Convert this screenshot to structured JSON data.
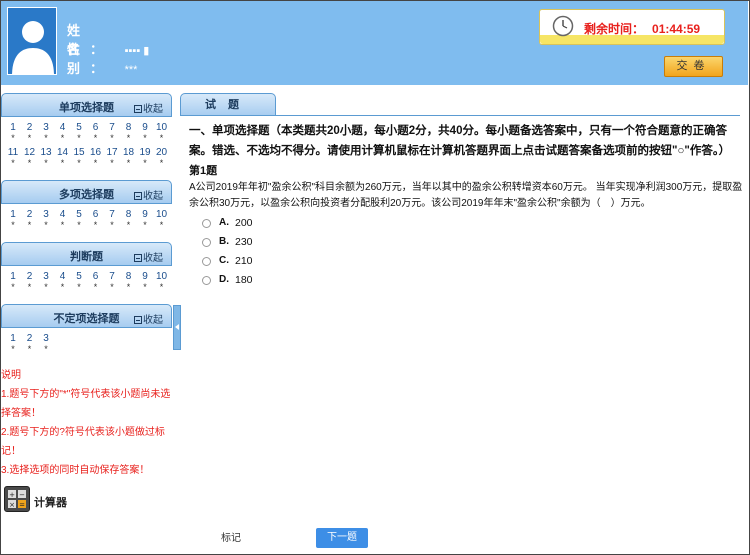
{
  "candidate": {
    "name_label": "姓名：",
    "name_value": "▪▪▪▪ ▮",
    "gender_label": "性别：",
    "gender_value": "***"
  },
  "timer": {
    "label": "剩余时间：",
    "value": "01:44:59",
    "icon": "clock-icon",
    "text_color": "#e8211d"
  },
  "submit_label": "交卷",
  "sidebar": {
    "collapse_label": "收起",
    "sections": [
      {
        "title": "单项选择题",
        "row1": [
          "1",
          "2",
          "3",
          "4",
          "5",
          "6",
          "7",
          "8",
          "9",
          "10"
        ],
        "row2": [
          "11",
          "12",
          "13",
          "14",
          "15",
          "16",
          "17",
          "18",
          "19",
          "20"
        ]
      },
      {
        "title": "多项选择题",
        "row1": [
          "1",
          "2",
          "3",
          "4",
          "5",
          "6",
          "7",
          "8",
          "9",
          "10"
        ]
      },
      {
        "title": "判断题",
        "row1": [
          "1",
          "2",
          "3",
          "4",
          "5",
          "6",
          "7",
          "8",
          "9",
          "10"
        ]
      },
      {
        "title": "不定项选择题",
        "row1": [
          "1",
          "2",
          "3"
        ]
      }
    ],
    "status_mark": "*"
  },
  "notes": {
    "title": "说明",
    "items": [
      "1.题号下方的\"*\"符号代表该小题尚未选择答案！",
      "2.题号下方的?符号代表该小题做过标记！",
      "3.选择选项的同时自动保存答案！"
    ]
  },
  "calculator_label": "计算器",
  "tab_label": "试题",
  "question": {
    "section_heading": "一、单项选择题（本类题共20小题，每小题2分，共40分。每小题备选答案中，只有一个符合题意的正确答案。错选、不选均不得分。请使用计算机鼠标在计算机答题界面上点击试题答案备选项前的按钮\"○\"作答。）",
    "number": "第1题",
    "stem": "A公司2019年年初\"盈余公积\"科目余额为260万元，当年以其中的盈余公积转增资本60万元。 当年实现净利润300万元，提取盈余公积30万元，以盈余公积向投资者分配股利20万元。该公司2019年年末\"盈余公积\"余额为（　）万元。",
    "options": [
      {
        "label": "A.",
        "text": "200"
      },
      {
        "label": "B.",
        "text": "230"
      },
      {
        "label": "C.",
        "text": "210"
      },
      {
        "label": "D.",
        "text": "180"
      }
    ]
  },
  "footer": {
    "mark_label": "标记",
    "next_label": "下一题"
  },
  "colors": {
    "header_bg": "#7fbcef",
    "accent_blue": "#3d8ee6",
    "warning_red": "#e8211d",
    "submit_orange": "#f2a41c"
  }
}
